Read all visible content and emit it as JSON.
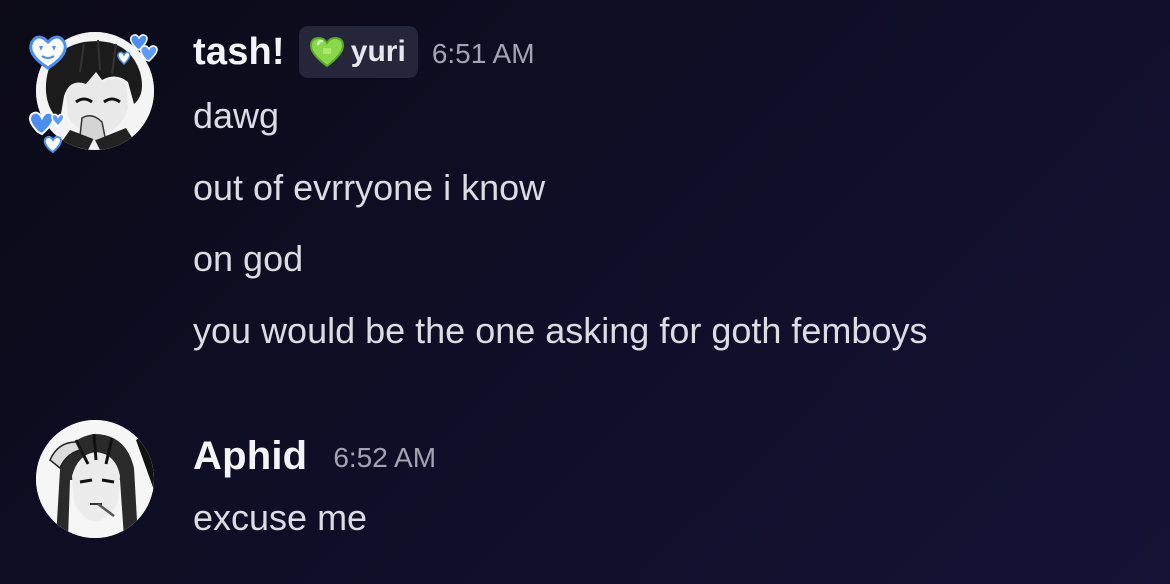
{
  "messages": [
    {
      "author": "tash!",
      "tag": {
        "icon": "green-heart-icon",
        "label": "yuri",
        "color": "#8ad84a"
      },
      "time": "6:51 AM",
      "lines": [
        "dawg",
        "out of evrryone i know",
        "on god",
        "you would be the one asking for goth femboys"
      ],
      "avatar": {
        "icon": "anime-avatar-with-blue-hearts",
        "accent": "#4a8ef0"
      }
    },
    {
      "author": "Aphid",
      "time": "6:52 AM",
      "lines": [
        "excuse me"
      ],
      "avatar": {
        "icon": "anime-avatar-monochrome"
      }
    }
  ],
  "colors": {
    "background": "#0f0e26",
    "username": "#f4f4f8",
    "text": "#dcdce4",
    "timestamp": "#a3a3b3",
    "tag_bg": "#26263a"
  }
}
